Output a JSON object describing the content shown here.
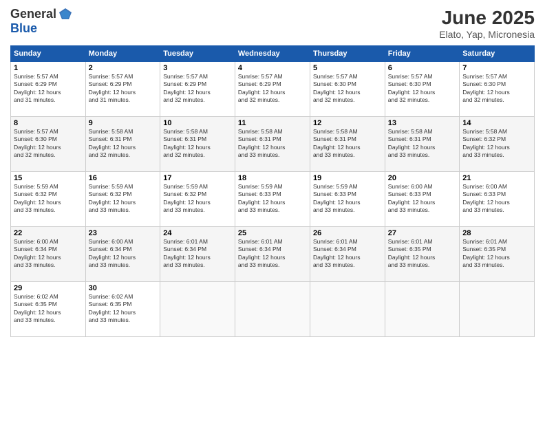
{
  "header": {
    "logo_line1": "General",
    "logo_line2": "Blue",
    "main_title": "June 2025",
    "sub_title": "Elato, Yap, Micronesia"
  },
  "days_of_week": [
    "Sunday",
    "Monday",
    "Tuesday",
    "Wednesday",
    "Thursday",
    "Friday",
    "Saturday"
  ],
  "weeks": [
    [
      {
        "day": "1",
        "info": "Sunrise: 5:57 AM\nSunset: 6:29 PM\nDaylight: 12 hours\nand 31 minutes."
      },
      {
        "day": "2",
        "info": "Sunrise: 5:57 AM\nSunset: 6:29 PM\nDaylight: 12 hours\nand 31 minutes."
      },
      {
        "day": "3",
        "info": "Sunrise: 5:57 AM\nSunset: 6:29 PM\nDaylight: 12 hours\nand 32 minutes."
      },
      {
        "day": "4",
        "info": "Sunrise: 5:57 AM\nSunset: 6:29 PM\nDaylight: 12 hours\nand 32 minutes."
      },
      {
        "day": "5",
        "info": "Sunrise: 5:57 AM\nSunset: 6:30 PM\nDaylight: 12 hours\nand 32 minutes."
      },
      {
        "day": "6",
        "info": "Sunrise: 5:57 AM\nSunset: 6:30 PM\nDaylight: 12 hours\nand 32 minutes."
      },
      {
        "day": "7",
        "info": "Sunrise: 5:57 AM\nSunset: 6:30 PM\nDaylight: 12 hours\nand 32 minutes."
      }
    ],
    [
      {
        "day": "8",
        "info": "Sunrise: 5:57 AM\nSunset: 6:30 PM\nDaylight: 12 hours\nand 32 minutes."
      },
      {
        "day": "9",
        "info": "Sunrise: 5:58 AM\nSunset: 6:31 PM\nDaylight: 12 hours\nand 32 minutes."
      },
      {
        "day": "10",
        "info": "Sunrise: 5:58 AM\nSunset: 6:31 PM\nDaylight: 12 hours\nand 32 minutes."
      },
      {
        "day": "11",
        "info": "Sunrise: 5:58 AM\nSunset: 6:31 PM\nDaylight: 12 hours\nand 33 minutes."
      },
      {
        "day": "12",
        "info": "Sunrise: 5:58 AM\nSunset: 6:31 PM\nDaylight: 12 hours\nand 33 minutes."
      },
      {
        "day": "13",
        "info": "Sunrise: 5:58 AM\nSunset: 6:31 PM\nDaylight: 12 hours\nand 33 minutes."
      },
      {
        "day": "14",
        "info": "Sunrise: 5:58 AM\nSunset: 6:32 PM\nDaylight: 12 hours\nand 33 minutes."
      }
    ],
    [
      {
        "day": "15",
        "info": "Sunrise: 5:59 AM\nSunset: 6:32 PM\nDaylight: 12 hours\nand 33 minutes."
      },
      {
        "day": "16",
        "info": "Sunrise: 5:59 AM\nSunset: 6:32 PM\nDaylight: 12 hours\nand 33 minutes."
      },
      {
        "day": "17",
        "info": "Sunrise: 5:59 AM\nSunset: 6:32 PM\nDaylight: 12 hours\nand 33 minutes."
      },
      {
        "day": "18",
        "info": "Sunrise: 5:59 AM\nSunset: 6:33 PM\nDaylight: 12 hours\nand 33 minutes."
      },
      {
        "day": "19",
        "info": "Sunrise: 5:59 AM\nSunset: 6:33 PM\nDaylight: 12 hours\nand 33 minutes."
      },
      {
        "day": "20",
        "info": "Sunrise: 6:00 AM\nSunset: 6:33 PM\nDaylight: 12 hours\nand 33 minutes."
      },
      {
        "day": "21",
        "info": "Sunrise: 6:00 AM\nSunset: 6:33 PM\nDaylight: 12 hours\nand 33 minutes."
      }
    ],
    [
      {
        "day": "22",
        "info": "Sunrise: 6:00 AM\nSunset: 6:34 PM\nDaylight: 12 hours\nand 33 minutes."
      },
      {
        "day": "23",
        "info": "Sunrise: 6:00 AM\nSunset: 6:34 PM\nDaylight: 12 hours\nand 33 minutes."
      },
      {
        "day": "24",
        "info": "Sunrise: 6:01 AM\nSunset: 6:34 PM\nDaylight: 12 hours\nand 33 minutes."
      },
      {
        "day": "25",
        "info": "Sunrise: 6:01 AM\nSunset: 6:34 PM\nDaylight: 12 hours\nand 33 minutes."
      },
      {
        "day": "26",
        "info": "Sunrise: 6:01 AM\nSunset: 6:34 PM\nDaylight: 12 hours\nand 33 minutes."
      },
      {
        "day": "27",
        "info": "Sunrise: 6:01 AM\nSunset: 6:35 PM\nDaylight: 12 hours\nand 33 minutes."
      },
      {
        "day": "28",
        "info": "Sunrise: 6:01 AM\nSunset: 6:35 PM\nDaylight: 12 hours\nand 33 minutes."
      }
    ],
    [
      {
        "day": "29",
        "info": "Sunrise: 6:02 AM\nSunset: 6:35 PM\nDaylight: 12 hours\nand 33 minutes."
      },
      {
        "day": "30",
        "info": "Sunrise: 6:02 AM\nSunset: 6:35 PM\nDaylight: 12 hours\nand 33 minutes."
      },
      {
        "day": "",
        "info": ""
      },
      {
        "day": "",
        "info": ""
      },
      {
        "day": "",
        "info": ""
      },
      {
        "day": "",
        "info": ""
      },
      {
        "day": "",
        "info": ""
      }
    ]
  ]
}
